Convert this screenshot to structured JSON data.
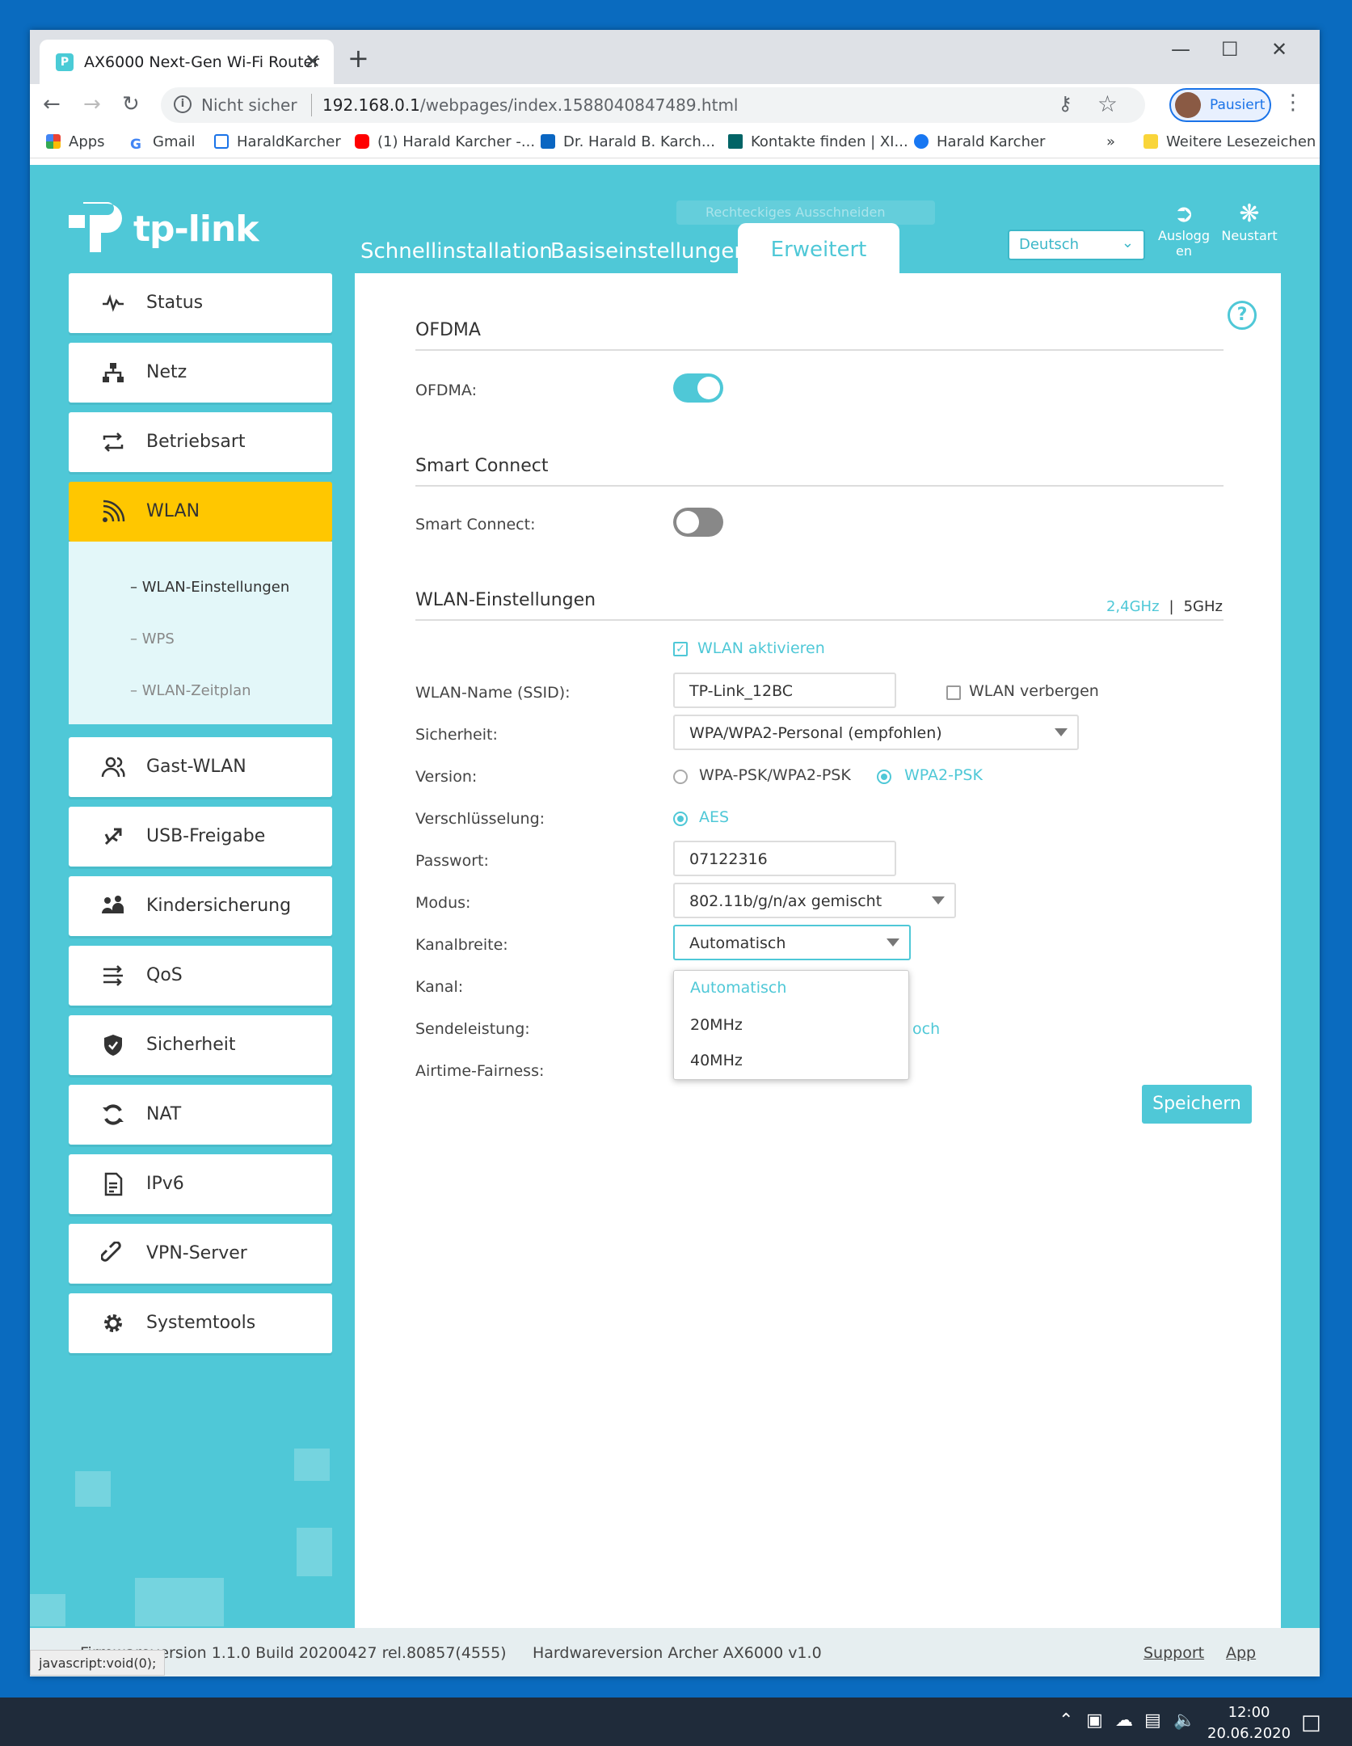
{
  "browser": {
    "tab_title": "AX6000 Next-Gen Wi-Fi Router",
    "tab_close": "✕",
    "new_tab": "+",
    "not_secure": "Nicht sicher",
    "url_host": "192.168.0.1",
    "url_path": "/webpages/index.1588040847489.html",
    "profile_label": "Pausiert",
    "bookmarks": [
      {
        "label": "Apps",
        "color": "#ea4335"
      },
      {
        "label": "Gmail",
        "color": "#ffffff"
      },
      {
        "label": "HaraldKarcher",
        "color": "#1a73e8"
      },
      {
        "label": "(1) Harald Karcher -...",
        "color": "#ff0000"
      },
      {
        "label": "Dr. Harald B. Karch...",
        "color": "#0a66c2"
      },
      {
        "label": "Kontakte finden | XI...",
        "color": "#026466"
      },
      {
        "label": "Harald Karcher",
        "color": "#1877f2"
      }
    ],
    "bookmarks_more": "»",
    "other_bookmarks": "Weitere Lesezeichen"
  },
  "router": {
    "brand": "tp-link",
    "ghost_tooltip": "Rechteckiges Ausschneiden",
    "nav": {
      "quick": "Schnellinstallation",
      "basic": "Basiseinstellungen",
      "advanced": "Erweitert"
    },
    "language": "Deutsch",
    "logout": "Ausloggen",
    "reboot": "Neustart",
    "sidebar": [
      {
        "label": "Status"
      },
      {
        "label": "Netz"
      },
      {
        "label": "Betriebsart"
      },
      {
        "label": "WLAN"
      },
      {
        "label": "Gast-WLAN"
      },
      {
        "label": "USB-Freigabe"
      },
      {
        "label": "Kindersicherung"
      },
      {
        "label": "QoS"
      },
      {
        "label": "Sicherheit"
      },
      {
        "label": "NAT"
      },
      {
        "label": "IPv6"
      },
      {
        "label": "VPN-Server"
      },
      {
        "label": "Systemtools"
      }
    ],
    "wlan_sub": [
      "WLAN-Einstellungen",
      "WPS",
      "WLAN-Zeitplan"
    ]
  },
  "content": {
    "ofdma": {
      "title": "OFDMA",
      "label": "OFDMA:",
      "enabled": true
    },
    "smart_connect": {
      "title": "Smart Connect",
      "label": "Smart Connect:",
      "enabled": false
    },
    "wlan": {
      "title": "WLAN-Einstellungen",
      "band_24": "2,4GHz",
      "band_sep": "|",
      "band_5": "5GHz",
      "enable_label": "WLAN aktivieren",
      "ssid_label": "WLAN-Name (SSID):",
      "ssid_value": "TP-Link_12BC",
      "hide_label": "WLAN verbergen",
      "security_label": "Sicherheit:",
      "security_value": "WPA/WPA2-Personal (empfohlen)",
      "version_label": "Version:",
      "version_opt1": "WPA-PSK/WPA2-PSK",
      "version_opt2": "WPA2-PSK",
      "encryption_label": "Verschlüsselung:",
      "encryption_value": "AES",
      "password_label": "Passwort:",
      "password_value": "07122316",
      "mode_label": "Modus:",
      "mode_value": "802.11b/g/n/ax gemischt",
      "bandwidth_label": "Kanalbreite:",
      "bandwidth_value": "Automatisch",
      "bandwidth_options": [
        "Automatisch",
        "20MHz",
        "40MHz"
      ],
      "channel_label": "Kanal:",
      "power_label": "Sendeleistung:",
      "power_peek": "och",
      "airtime_label": "Airtime-Fairness:"
    },
    "save_label": "Speichern"
  },
  "footer": {
    "firmware": "Firmwareversion 1.1.0 Build 20200427 rel.80857(4555)",
    "hardware": "Hardwareversion Archer AX6000 v1.0",
    "support": "Support",
    "app": "App"
  },
  "statusbar": "javascript:void(0);",
  "taskbar": {
    "time": "12:00",
    "date": "20.06.2020"
  },
  "colors": {
    "accent": "#4fc8d7",
    "active_menu": "#ffc700"
  }
}
